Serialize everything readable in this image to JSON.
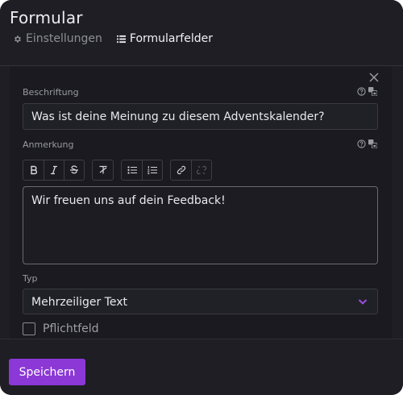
{
  "window": {
    "title": "Formular"
  },
  "tabs": [
    {
      "label": "Einstellungen",
      "icon": "gear-icon",
      "active": false
    },
    {
      "label": "Formularfelder",
      "icon": "list-icon",
      "active": true
    }
  ],
  "form": {
    "caption": {
      "label": "Beschriftung",
      "value": "Was ist deine Meinung zu diesem Adventskalender?"
    },
    "note": {
      "label": "Anmerkung",
      "value": "Wir freuen uns auf dein Feedback!"
    },
    "toolbar": [
      "bold-icon",
      "italic-icon",
      "strikethrough-icon",
      "clear-format-icon",
      "bullet-list-icon",
      "numbered-list-icon",
      "link-icon",
      "unlink-icon"
    ],
    "type": {
      "label": "Typ",
      "value": "Mehrzeiliger Text"
    },
    "required": {
      "label": "Pflichtfeld",
      "checked": false
    }
  },
  "footer": {
    "save_label": "Speichern"
  },
  "colors": {
    "accent": "#8b38d6",
    "background": "#1e1e24",
    "chevron": "#9b4fe0"
  }
}
